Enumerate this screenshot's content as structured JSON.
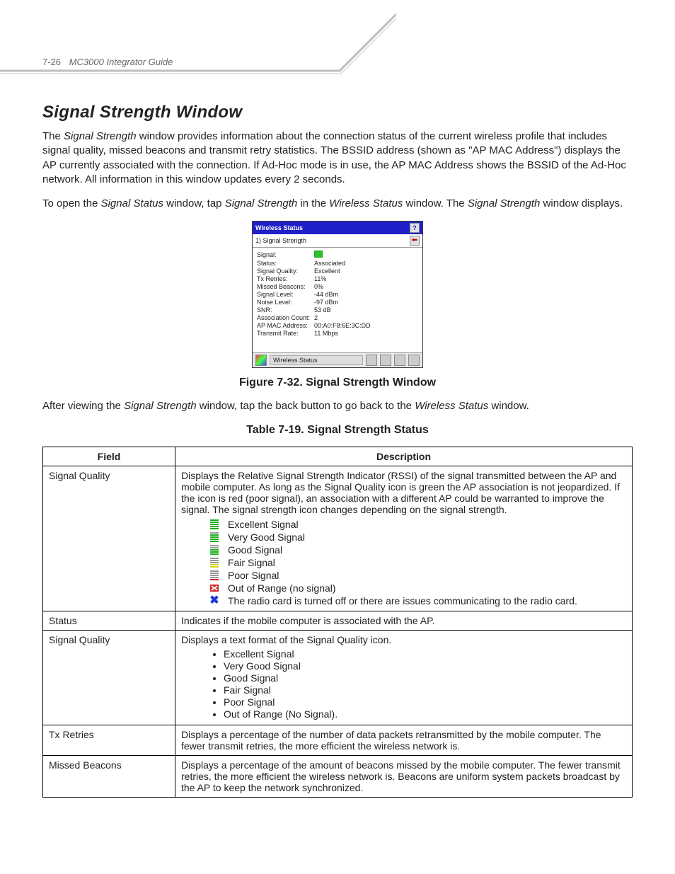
{
  "header": {
    "page_number": "7-26",
    "guide_title": "MC3000 Integrator Guide"
  },
  "section_title": "Signal Strength Window",
  "para1_a": "The ",
  "para1_b": "Signal Strength",
  "para1_c": " window provides information about the connection status of the current wireless profile that includes signal quality, missed beacons and transmit retry statistics. The BSSID address (shown as \"AP MAC Address\") displays the AP currently associated with the connection. If Ad-Hoc mode is in use, the AP MAC Address shows the BSSID of the Ad-Hoc network. All information in this window updates every 2 seconds.",
  "para2_a": "To open the ",
  "para2_b": "Signal Status",
  "para2_c": " window, tap ",
  "para2_d": "Signal Strength",
  "para2_e": " in the ",
  "para2_f": "Wireless Status",
  "para2_g": " window. The ",
  "para2_h": "Signal Strength",
  "para2_i": " window displays.",
  "mock": {
    "title": "Wireless Status",
    "subtitle": "1) Signal Strength",
    "rows": [
      {
        "k": "Signal:",
        "v": "__SIGBOX__"
      },
      {
        "k": "Status:",
        "v": "Associated"
      },
      {
        "k": "Signal Quality:",
        "v": "Excellent"
      },
      {
        "k": "Tx Retries:",
        "v": "11%"
      },
      {
        "k": "Missed Beacons:",
        "v": "0%"
      },
      {
        "k": "Signal Level:",
        "v": "-44 dBm"
      },
      {
        "k": "Noise Level:",
        "v": "-97 dBm"
      },
      {
        "k": "SNR:",
        "v": "53 dB"
      },
      {
        "k": "Association Count:",
        "v": "2"
      },
      {
        "k": "AP MAC Address:",
        "v": "00:A0:F8:6E:3C:DD"
      },
      {
        "k": "Transmit Rate:",
        "v": "11 Mbps"
      }
    ],
    "taskbar_label": "Wireless Status"
  },
  "figure_caption": "Figure 7-32.  Signal Strength Window",
  "para3_a": "After viewing the ",
  "para3_b": "Signal Strength",
  "para3_c": " window, tap the back button to go back to the ",
  "para3_d": "Wireless Status",
  "para3_e": " window.",
  "table_caption": "Table 7-19. Signal Strength Status",
  "table": {
    "head_field": "Field",
    "head_desc": "Description",
    "rows": {
      "sq1": {
        "field": "Signal Quality",
        "desc_intro": "Displays the Relative Signal Strength Indicator (RSSI) of the signal transmitted between the AP and mobile computer. As long as the Signal Quality icon is green the AP association is not jeopardized. If the icon is red (poor signal), an association with a different AP could be warranted to improve the signal. The signal strength icon changes depending on the signal strength.",
        "levels": [
          "Excellent Signal",
          "Very Good Signal",
          "Good Signal",
          "Fair Signal",
          "Poor Signal",
          "Out of Range (no signal)",
          "The radio card is turned off or there are issues communicating to the radio card."
        ]
      },
      "status": {
        "field": "Status",
        "desc": "Indicates if the mobile computer is associated with the AP."
      },
      "sq2": {
        "field": "Signal Quality",
        "desc_intro": "Displays a text format of the Signal Quality icon.",
        "bullets": [
          "Excellent Signal",
          "Very Good Signal",
          "Good Signal",
          "Fair Signal",
          "Poor Signal",
          "Out of Range (No Signal)."
        ]
      },
      "tx": {
        "field": "Tx Retries",
        "desc": "Displays a percentage of the number of data packets retransmitted by the mobile computer. The fewer transmit retries, the more efficient the wireless network is."
      },
      "mb": {
        "field": "Missed Beacons",
        "desc": "Displays a percentage of the amount of beacons missed by the mobile computer. The fewer transmit retries, the more efficient the wireless network is. Beacons are uniform system packets broadcast by the AP to keep the network synchronized."
      }
    }
  }
}
